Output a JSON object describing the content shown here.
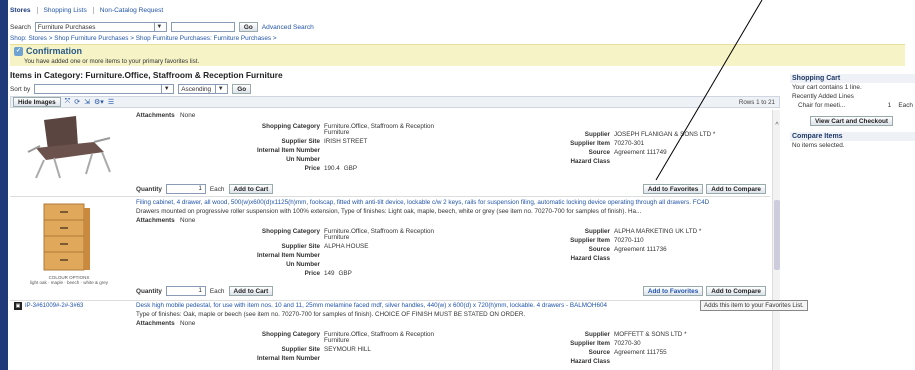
{
  "topnav": [
    "Stores",
    "Shopping Lists",
    "Non-Catalog Request"
  ],
  "search": {
    "label": "Search",
    "category_value": "Furniture Purchases",
    "go_label": "Go",
    "advanced_label": "Advanced Search"
  },
  "breadcrumb": "Shop: Stores  >  Shop Furniture Purchases  >  Shop Furniture Purchases: Furniture Purchases  >",
  "confirmation": {
    "title": "Confirmation",
    "message": "You have added one or more items to your primary favorites list."
  },
  "category_title": "Items in Category: Furniture.Office, Staffroom & Reception Furniture",
  "sort": {
    "label": "Sort by",
    "order_value": "Ascending",
    "go_label": "Go"
  },
  "toolbar": {
    "hide_images_label": "Hide Images",
    "rows_label": "Rows 1 to 21"
  },
  "field_labels": {
    "attachments": "Attachments",
    "shopping_category": "Shopping Category",
    "supplier_site": "Supplier Site",
    "internal_item_number": "Internal Item Number",
    "un_number": "Un Number",
    "price": "Price",
    "supplier": "Supplier",
    "supplier_item": "Supplier Item",
    "source": "Source",
    "hazard_class": "Hazard Class",
    "quantity": "Quantity",
    "each": "Each",
    "add_to_cart": "Add to Cart",
    "add_to_favorites": "Add to Favorites",
    "add_to_compare": "Add to Compare"
  },
  "items": [
    {
      "attachments": "None",
      "category_line1": "Furniture.Office, Staffroom & Reception",
      "category_line2": "Furniture",
      "supplier_site": "IRISH STREET",
      "price": "190.4",
      "currency": "GBP",
      "supplier": "JOSEPH FLANIGAN & SONS LTD *",
      "supplier_item": "70270-301",
      "source": "Agreement 111749",
      "quantity": "1"
    },
    {
      "title": "Filing cabinet, 4 drawer, all wood, 500(w)x600(d)x1125(h)mm, foolscap, fitted with anti-tilt device, lockable c/w 2 keys, rails for suspension filing, automatic locking device operating through all drawers. FC4D",
      "description": "Drawers mounted on progressive roller suspension with 100% extension, Type of finishes: Light oak, maple, beech, white or grey (see item no. 70270-700 for samples of finish). Ha...",
      "attachments": "None",
      "category_line1": "Furniture.Office, Staffroom & Reception",
      "category_line2": "Furniture",
      "supplier_site": "ALPHA HOUSE",
      "price": "149",
      "currency": "GBP",
      "supplier": "ALPHA MARKETING UK LTD *",
      "supplier_item": "70270-110",
      "source": "Agreement 111736",
      "quantity": "1",
      "image_caption": "COLOUR OPTIONS",
      "image_caption2": "light oak · maple · beech · white & grey"
    },
    {
      "title": "Desk high mobile pedestal, for use with item nos. 10 and 11, 25mm melamine faced mdf, silver handles, 440(w) x 600(d) x 720(h)mm, lockable. 4 drawers - BALMOH604",
      "description": "Type of finishes: Oak, maple or beech (see item no. 70270-700 for samples of finish). CHOICE OF FINISH MUST BE STATED ON ORDER.",
      "attachments": "None",
      "category_line1": "Furniture.Office, Staffroom & Reception",
      "category_line2": "Furniture",
      "supplier_site": "SEYMOUR HILL",
      "supplier": "MOFFETT & SONS LTD *",
      "supplier_item": "70270-30",
      "source": "Agreement 111755",
      "image_label": "IP-3#61009#-2#-3#63"
    }
  ],
  "tooltip": "Adds this item to your Favorites List.",
  "cart": {
    "title": "Shopping Cart",
    "status": "Your cart contains 1 line.",
    "recent_label": "Recently Added Lines",
    "recent_item": "Chair for meeti...",
    "recent_qty": "1",
    "recent_uom": "Each",
    "view_label": "View Cart and Checkout"
  },
  "compare": {
    "title": "Compare Items",
    "status": "No items selected."
  }
}
